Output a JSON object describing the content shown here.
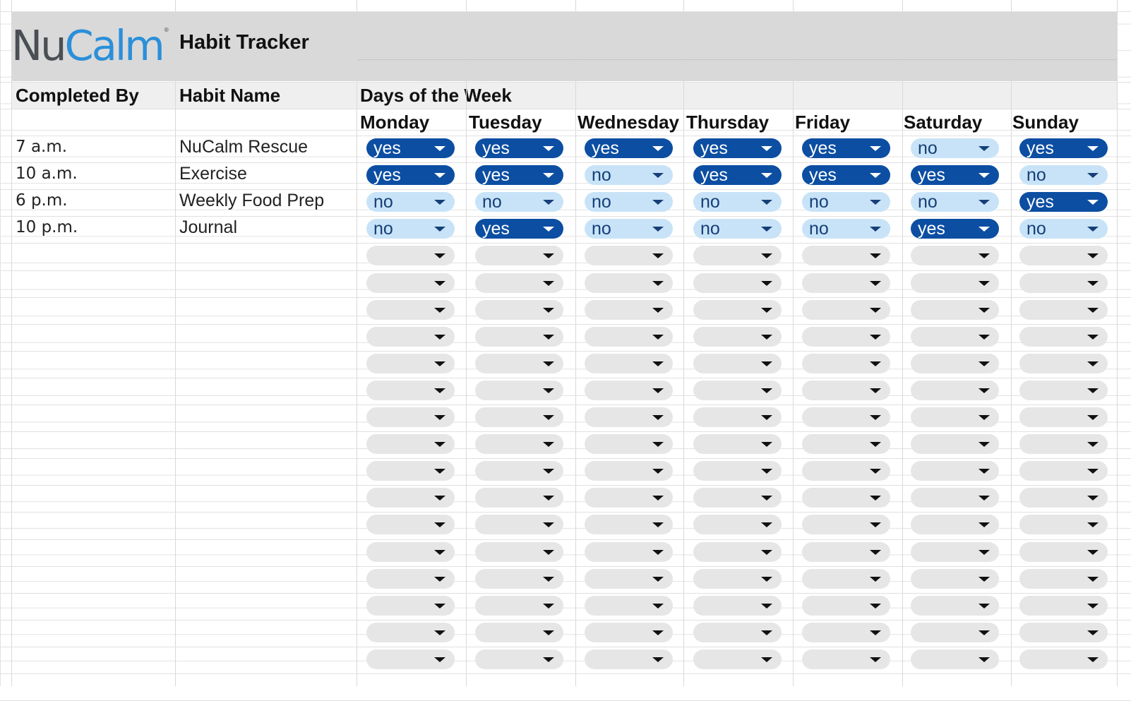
{
  "header": {
    "logo_nu": "Nu",
    "logo_calm": "Calm",
    "logo_reg": "®",
    "title": "Habit Tracker"
  },
  "columns": {
    "completed_by": "Completed By",
    "habit_name": "Habit Name",
    "days_of_week": "Days of the Week",
    "days": [
      "Monday",
      "Tuesday",
      "Wednesday",
      "Thursday",
      "Friday",
      "Saturday",
      "Sunday"
    ]
  },
  "rows": [
    {
      "time": "7 a.m.",
      "habit": "NuCalm Rescue",
      "values": [
        "yes",
        "yes",
        "yes",
        "yes",
        "yes",
        "no",
        "yes"
      ]
    },
    {
      "time": "10 a.m.",
      "habit": "Exercise",
      "values": [
        "yes",
        "yes",
        "no",
        "yes",
        "yes",
        "yes",
        "no"
      ]
    },
    {
      "time": "6 p.m.",
      "habit": "Weekly Food Prep",
      "values": [
        "no",
        "no",
        "no",
        "no",
        "no",
        "no",
        "yes"
      ]
    },
    {
      "time": "10 p.m.",
      "habit": "Journal",
      "values": [
        "no",
        "yes",
        "no",
        "no",
        "no",
        "yes",
        "no"
      ]
    }
  ],
  "empty_rows": 16,
  "colors": {
    "yes_bg": "#0c4ea2",
    "no_bg": "#c8e3f7",
    "empty_bg": "#e6e6e6",
    "header_band": "#d9d9d9"
  },
  "icons": {
    "dropdown": "chevron-down-icon"
  }
}
